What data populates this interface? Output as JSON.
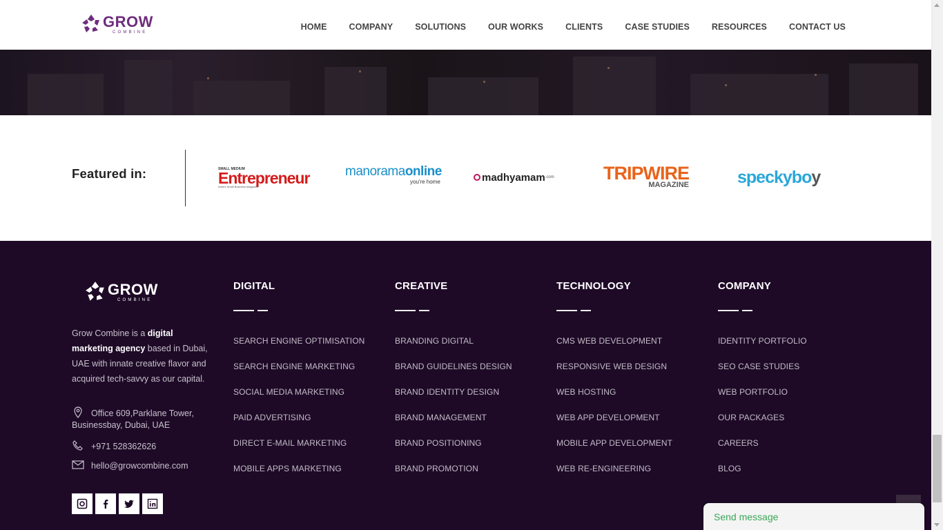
{
  "header": {
    "logo_word": "GROW",
    "logo_sub": "COMBINE",
    "nav": [
      "HOME",
      "COMPANY",
      "SOLUTIONS",
      "OUR WORKS",
      "CLIENTS",
      "CASE STUDIES",
      "RESOURCES",
      "CONTACT US"
    ]
  },
  "featured": {
    "title": "Featured in:",
    "brands": {
      "entrepreneur": {
        "small": "SMALL MEDIUM",
        "name": "Entrepreneur",
        "tag": "India's Small Business Magazine"
      },
      "manorama": {
        "name_a": "manorama",
        "name_b": "online",
        "tag": "you're home"
      },
      "madhyamam": {
        "name": "madhyamam",
        "com": ".com"
      },
      "tripwire": {
        "name": "TRIPWIRE",
        "tag": "MAGAZINE"
      },
      "speckyboy": {
        "name_a": "specky",
        "name_b": "bo",
        "name_c": "y"
      }
    }
  },
  "footer": {
    "logo_word": "GROW",
    "logo_sub": "COMBINE",
    "about_a": "Grow Combine is a ",
    "about_b": "digital marketing agency",
    "about_c": " based in Dubai, UAE with innate creative flavor and acquired tech-savvy as our capital.",
    "address": "Office 609,Parklane Tower, Businessbay, Dubai, UAE",
    "phone": "+971 528362626",
    "email": "hello@growcombine.com",
    "columns": [
      {
        "title": "DIGITAL",
        "items": [
          "SEARCH ENGINE OPTIMISATION",
          "SEARCH ENGINE MARKETING",
          "SOCIAL MEDIA MARKETING",
          "PAID ADVERTISING",
          "DIRECT E-MAIL MARKETING",
          "MOBILE APPS MARKETING"
        ]
      },
      {
        "title": "CREATIVE",
        "items": [
          "BRANDING DIGITAL",
          "BRAND GUIDELINES DESIGN",
          "BRAND IDENTITY DESIGN",
          "BRAND MANAGEMENT",
          "BRAND POSITIONING",
          "BRAND PROMOTION"
        ]
      },
      {
        "title": "TECHNOLOGY",
        "items": [
          "CMS WEB DEVELOPMENT",
          "RESPONSIVE WEB DESIGN",
          "WEB HOSTING",
          "WEB APP DEVELOPMENT",
          "MOBILE APP DEVELOPMENT",
          "WEB RE-ENGINEERING"
        ]
      },
      {
        "title": "COMPANY",
        "items": [
          "IDENTITY PORTFOLIO",
          "SEO CASE STUDIES",
          "WEB PORTFOLIO",
          "OUR PACKAGES",
          "CAREERS",
          "BLOG"
        ]
      }
    ],
    "social": [
      "instagram-icon",
      "facebook-icon",
      "twitter-icon",
      "linkedin-icon"
    ]
  },
  "chat": {
    "label": "Send message"
  },
  "colors": {
    "brand_purple": "#6e2d7e",
    "footer_bg": "#1e0a27",
    "chat_green": "#3aa757"
  }
}
